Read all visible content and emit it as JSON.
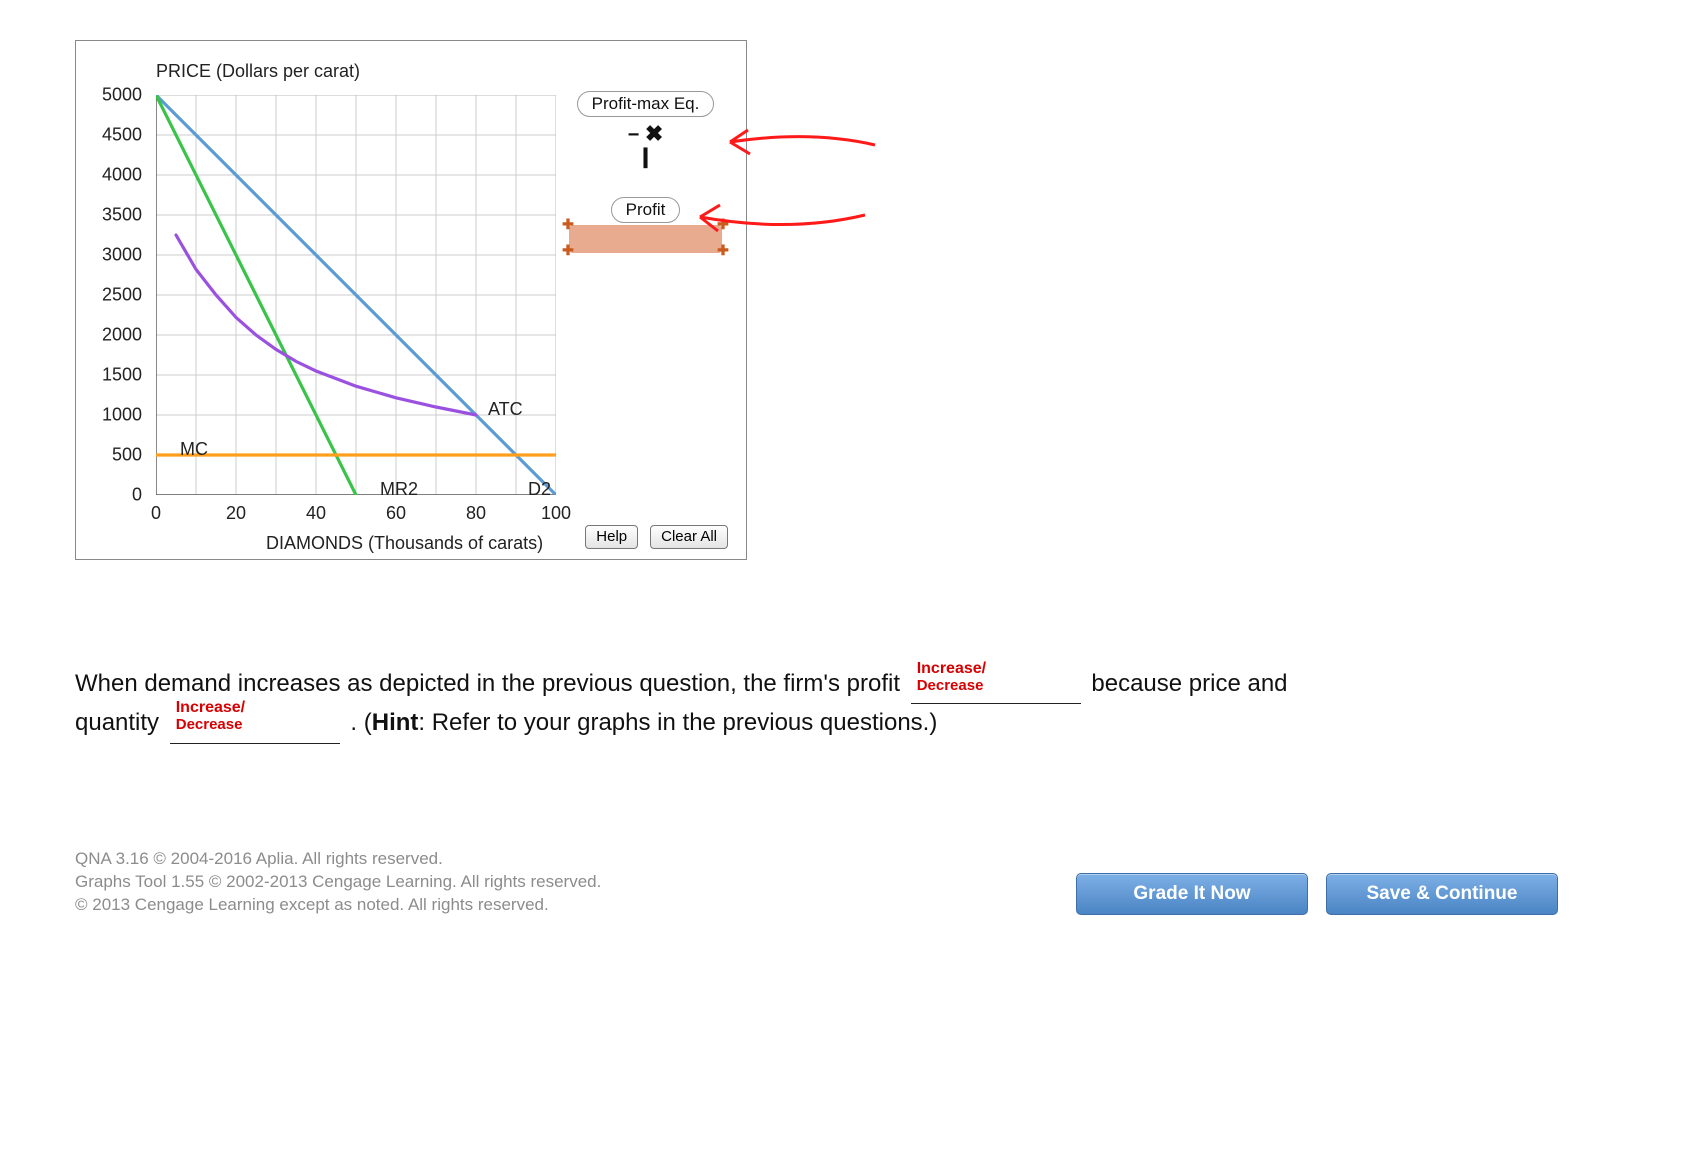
{
  "chart_data": {
    "type": "line",
    "title": "",
    "xlabel": "DIAMONDS (Thousands of carats)",
    "ylabel": "PRICE (Dollars per carat)",
    "xlim": [
      0,
      100
    ],
    "ylim": [
      0,
      5000
    ],
    "x_ticks": [
      0,
      20,
      40,
      60,
      80,
      100
    ],
    "y_ticks": [
      0,
      500,
      1000,
      1500,
      2000,
      2500,
      3000,
      3500,
      4000,
      4500,
      5000
    ],
    "series": [
      {
        "name": "D2",
        "color": "#5a9bd5",
        "x": [
          0,
          100
        ],
        "y": [
          5000,
          0
        ]
      },
      {
        "name": "MR2",
        "color": "#39c449",
        "x": [
          0,
          50
        ],
        "y": [
          5000,
          0
        ]
      },
      {
        "name": "MC",
        "color": "#ff9f1c",
        "x": [
          0,
          100
        ],
        "y": [
          500,
          500
        ]
      },
      {
        "name": "ATC",
        "color": "#9b51e0",
        "x": [
          5,
          10,
          15,
          20,
          25,
          30,
          35,
          40,
          50,
          60,
          70,
          80
        ],
        "y": [
          3250,
          2820,
          2500,
          2220,
          2000,
          1820,
          1670,
          1550,
          1360,
          1215,
          1100,
          1000
        ]
      }
    ],
    "curve_labels": [
      {
        "text": "MC",
        "x": 5,
        "y": 550
      },
      {
        "text": "MR2",
        "x": 55,
        "y": 50
      },
      {
        "text": "D2",
        "x": 92,
        "y": 50
      },
      {
        "text": "ATC",
        "x": 82,
        "y": 1050
      }
    ]
  },
  "tools": {
    "profit_max_label": "Profit-max Eq.",
    "profit_label": "Profit"
  },
  "buttons": {
    "help": "Help",
    "clear_all": "Clear All",
    "grade": "Grade It Now",
    "save": "Save & Continue"
  },
  "question": {
    "part1": "When demand increases as depicted in the previous question, the firm's profit ",
    "part2": " because price and quantity ",
    "part3": " . (",
    "hint_label": "Hint",
    "hint_text": ": Refer to your graphs in the previous questions.)",
    "blank_annot_line1": "Increase/",
    "blank_annot_line2": "Decrease"
  },
  "copyright": {
    "line1": "QNA 3.16 © 2004-2016 Aplia. All rights reserved.",
    "line2": "Graphs Tool 1.55 © 2002-2013 Cengage Learning. All rights reserved.",
    "line3": "© 2013 Cengage Learning except as noted. All rights reserved."
  }
}
